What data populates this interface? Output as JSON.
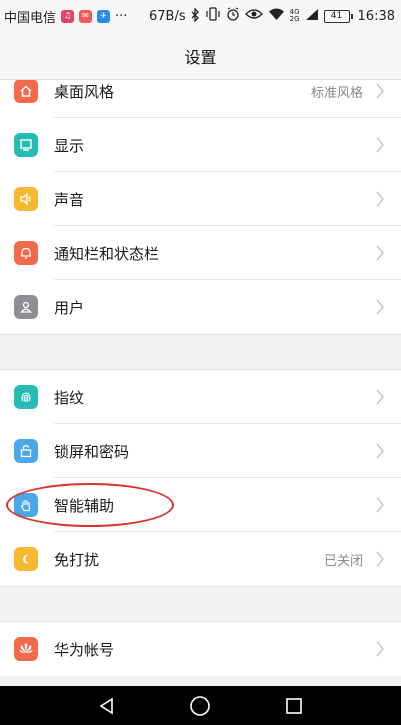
{
  "status_bar": {
    "carrier": "中国电信",
    "more": "···",
    "net_speed": "67B/s",
    "net_type_top": "4G",
    "net_type_bottom": "2G",
    "battery": "41",
    "time": "16:38"
  },
  "header": {
    "title": "设置"
  },
  "groups": [
    {
      "items": [
        {
          "label": "桌面风格",
          "value": "标准风格",
          "icon": "house-icon",
          "color": "#f26a4b"
        },
        {
          "label": "显示",
          "value": "",
          "icon": "display-icon",
          "color": "#25bdb3"
        },
        {
          "label": "声音",
          "value": "",
          "icon": "speaker-icon",
          "color": "#f6b830"
        },
        {
          "label": "通知栏和状态栏",
          "value": "",
          "icon": "bell-icon",
          "color": "#f26a4b"
        },
        {
          "label": "用户",
          "value": "",
          "icon": "user-icon",
          "color": "#8e8e93"
        }
      ]
    },
    {
      "items": [
        {
          "label": "指纹",
          "value": "",
          "icon": "fingerprint-icon",
          "color": "#25bdb3"
        },
        {
          "label": "锁屏和密码",
          "value": "",
          "icon": "lock-icon",
          "color": "#4aa8e8"
        },
        {
          "label": "智能辅助",
          "value": "",
          "icon": "hand-icon",
          "color": "#4aa8e8"
        },
        {
          "label": "免打扰",
          "value": "已关闭",
          "icon": "moon-icon",
          "color": "#f6b830"
        }
      ]
    },
    {
      "items": [
        {
          "label": "华为帐号",
          "value": "",
          "icon": "huawei-icon",
          "color": "#f26a4b"
        }
      ]
    }
  ],
  "colors": {
    "annotation": "#d9342b",
    "background": "#f2f2f2"
  }
}
